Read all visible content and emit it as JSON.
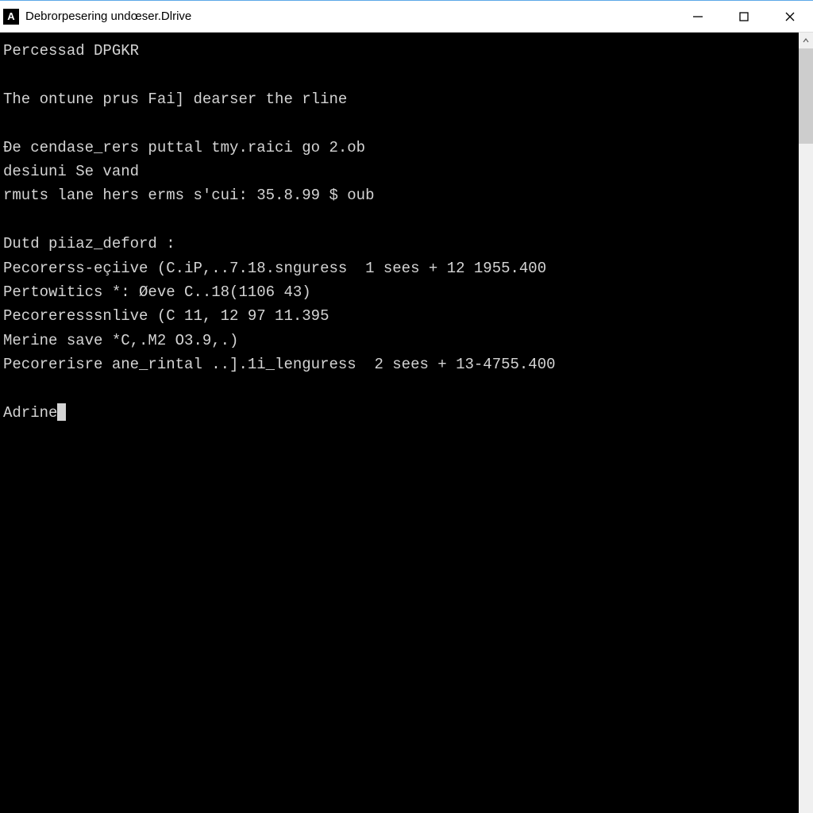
{
  "window": {
    "app_icon_letter": "A",
    "title": "Debrorpesering undœser.Dlrive"
  },
  "terminal": {
    "lines": [
      "Percessad DPGKR",
      "",
      "The ontune prus Fai] dearser the rline",
      "",
      "Đe cendase_rers puttal tmy.raici go 2.ob",
      "desiuni Se vand",
      "rmuts lane hers erms s'cui: 35.8.99 $ oub",
      "",
      "Dutd piiaz_deford :",
      "Pecorerss-eçiive (C.iP,..7.18.snguress  1 sees + 12 1955.400",
      "Pertowitics *: Øeve C..18(1106 43)",
      "Pecoreresssnlive (C 11, 12 97 11.395",
      "Merine save *C,.M2 O3.9,.)",
      "Pecorerisre ane_rintal ..].1i_lenguress  2 sees + 13-4755.400",
      ""
    ],
    "prompt": "Adrine"
  }
}
